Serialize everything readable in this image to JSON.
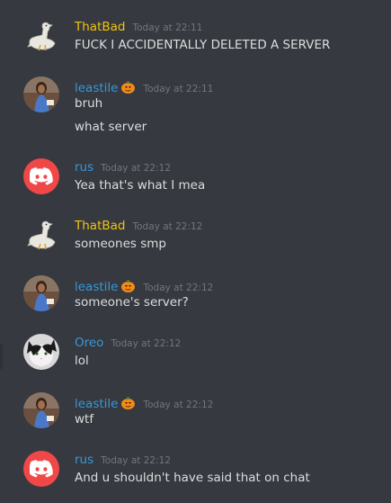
{
  "colors": {
    "background": "#36393f",
    "username_yellow": "#f1c40f",
    "username_blue": "#3498db",
    "text": "#dcddde",
    "timestamp": "#72767d",
    "discord_red": "#f04747"
  },
  "messages": [
    {
      "user": "ThatBad",
      "avatar": "goose-avatar",
      "color": "#f1c40f",
      "badge": false,
      "time": "Today at 22:11",
      "lines": [
        "FUCK I ACCIDENTALLY DELETED A SERVER"
      ]
    },
    {
      "user": "leastile",
      "avatar": "photo-avatar",
      "color": "#3498db",
      "badge": true,
      "time": "Today at 22:11",
      "lines": [
        "bruh",
        "what server"
      ]
    },
    {
      "user": "rus",
      "avatar": "discord-default-avatar",
      "color": "#3498db",
      "badge": false,
      "time": "Today at 22:12",
      "lines": [
        "Yea that's what I mea"
      ]
    },
    {
      "user": "ThatBad",
      "avatar": "goose-avatar",
      "color": "#f1c40f",
      "badge": false,
      "time": "Today at 22:12",
      "lines": [
        "someones smp"
      ]
    },
    {
      "user": "leastile",
      "avatar": "photo-avatar",
      "color": "#3498db",
      "badge": true,
      "time": "Today at 22:12",
      "lines": [
        "someone's server?"
      ]
    },
    {
      "user": "Oreo",
      "avatar": "cat-avatar",
      "color": "#3498db",
      "badge": false,
      "time": "Today at 22:12",
      "lines": [
        "lol"
      ]
    },
    {
      "user": "leastile",
      "avatar": "photo-avatar",
      "color": "#3498db",
      "badge": true,
      "time": "Today at 22:12",
      "lines": [
        "wtf"
      ]
    },
    {
      "user": "rus",
      "avatar": "discord-default-avatar",
      "color": "#3498db",
      "badge": false,
      "time": "Today at 22:12",
      "lines": [
        "And u shouldn't have said that on chat"
      ]
    }
  ]
}
